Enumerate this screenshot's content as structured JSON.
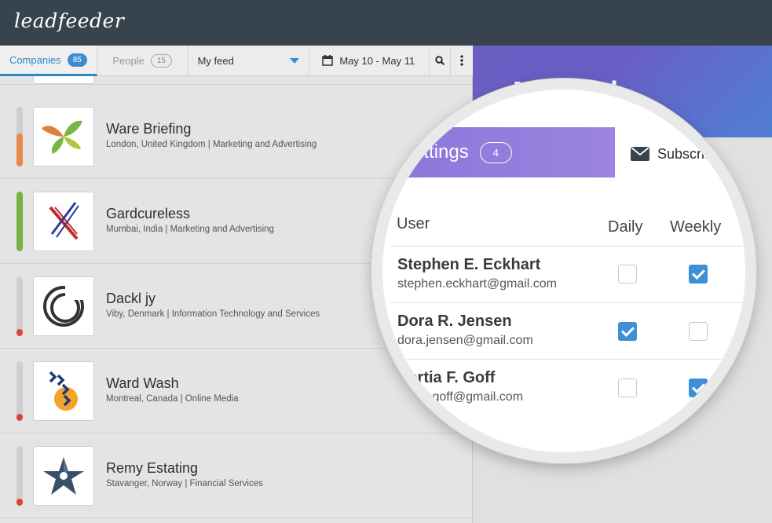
{
  "app": {
    "logo": "leadfeeder"
  },
  "toolbar": {
    "companies_label": "Companies",
    "companies_count": "85",
    "people_label": "People",
    "people_count": "15",
    "feed_selected": "My feed",
    "date_range": "May 10 - May 11"
  },
  "companies": [
    {
      "name": "Ware Briefing",
      "meta": "London, United Kingdom | Marketing and Advertising",
      "score": 0.55,
      "color": "#e48a4a",
      "logo_icon": "leaf-logo-icon"
    },
    {
      "name": "Gardcureless",
      "meta": "Mumbai, India | Marketing and Advertising",
      "score": 1.0,
      "color": "#78b144",
      "logo_icon": "cross-logo-icon"
    },
    {
      "name": "Dackl jy",
      "meta": "Viby, Denmark | Information Technology and Services",
      "score": 0.12,
      "color": "#d9453b",
      "logo_icon": "rings-logo-icon"
    },
    {
      "name": "Ward Wash",
      "meta": "Montreal, Canada | Online Media",
      "score": 0.12,
      "color": "#d9453b",
      "logo_icon": "chevrons-logo-icon"
    },
    {
      "name": "Remy Estating",
      "meta": "Stavanger, Norway | Financial Services",
      "score": 0.12,
      "color": "#d9453b",
      "logo_icon": "star-logo-icon"
    }
  ],
  "feed_panel": {
    "title": "My feed",
    "settings_tab": "Settings",
    "settings_count": "4",
    "subscribers_tab": "Subscribers",
    "columns": {
      "user": "User",
      "daily": "Daily",
      "weekly": "Weekly"
    },
    "subscribers": [
      {
        "name": "Stephen E. Eckhart",
        "email": "stephen.eckhart@gmail.com",
        "daily": false,
        "weekly": true
      },
      {
        "name": "Dora R. Jensen",
        "email": "dora.jensen@gmail.com",
        "daily": true,
        "weekly": false
      },
      {
        "name": "Portia F. Goff",
        "email": "portia.goff@gmail.com",
        "daily": false,
        "weekly": true
      }
    ]
  },
  "colors": {
    "accent": "#3a8dd0",
    "topbar": "#37434d",
    "hero_gradient_start": "#6b5fc4",
    "hero_gradient_end": "#4f7fd3"
  }
}
